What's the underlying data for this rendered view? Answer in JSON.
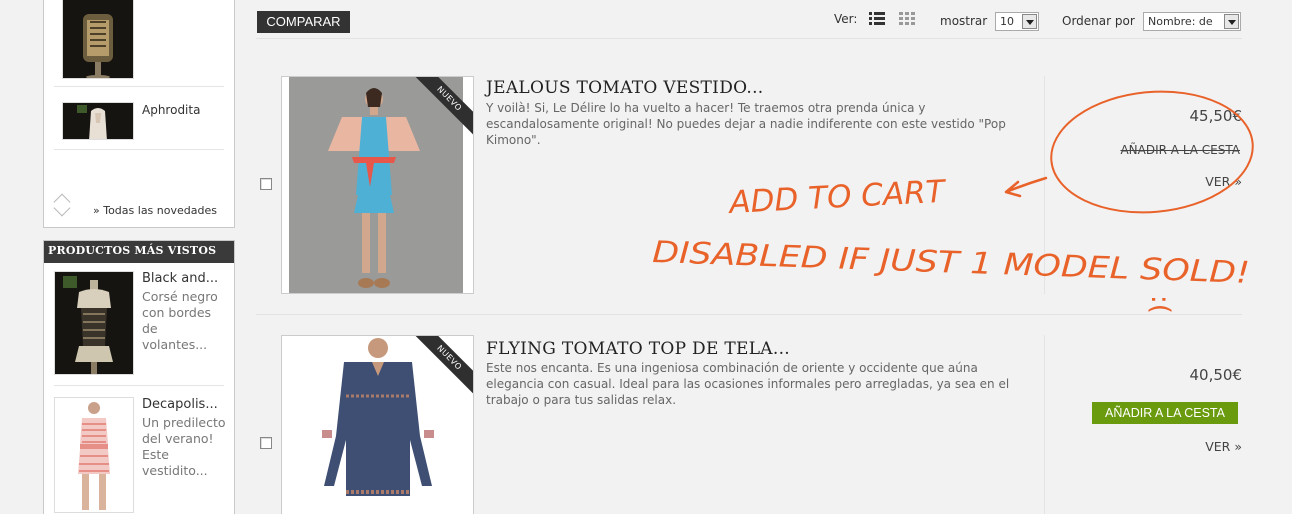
{
  "sidebar": {
    "top_item_name": "Aphrodita",
    "all_new_link": "» Todas las novedades",
    "most_viewed_title": "PRODUCTOS MÁS VISTOS",
    "viewed_items": [
      {
        "name": "Black and...",
        "desc": "Corsé negro con bordes de volantes..."
      },
      {
        "name": "Decapolis...",
        "desc": "Un predilecto del verano! Este vestidito..."
      }
    ]
  },
  "toolbar": {
    "compare_label": "COMPARAR",
    "view_label": "Ver:",
    "show_label": "mostrar",
    "show_value": "10",
    "sort_label": "Ordenar por",
    "sort_value": "Nombre: de"
  },
  "products": [
    {
      "badge": "NUEVO",
      "title": "JEALOUS TOMATO VESTIDO...",
      "desc": "Y voilà! Si, Le Délire lo ha vuelto a hacer! Te traemos otra prenda única y escandalosamente original! No puedes dejar a nadie indiferente con este vestido \"Pop Kimono\".",
      "price": "45,50€",
      "cart_label": "AÑADIR A LA CESTA",
      "cart_enabled": false,
      "view_label": "VER »"
    },
    {
      "badge": "NUEVO",
      "title": "FLYING TOMATO TOP DE TELA...",
      "desc": "Este nos encanta. Es una ingeniosa combinación de oriente y occidente que aúna elegancia con casual. Ideal para las ocasiones informales pero arregladas, ya sea en el trabajo o para tus salidas relax.",
      "price": "40,50€",
      "cart_label": "AÑADIR A LA CESTA",
      "cart_enabled": true,
      "view_label": "VER »"
    }
  ],
  "annotation": {
    "line1": "ADD TO CART",
    "line2": "DISABLED IF JUST 1 MODEL SOLD!",
    "face": ":(",
    "color": "#e8622a"
  },
  "colors": {
    "cart_button": "#6a9a0e",
    "compare_button": "#333333"
  }
}
